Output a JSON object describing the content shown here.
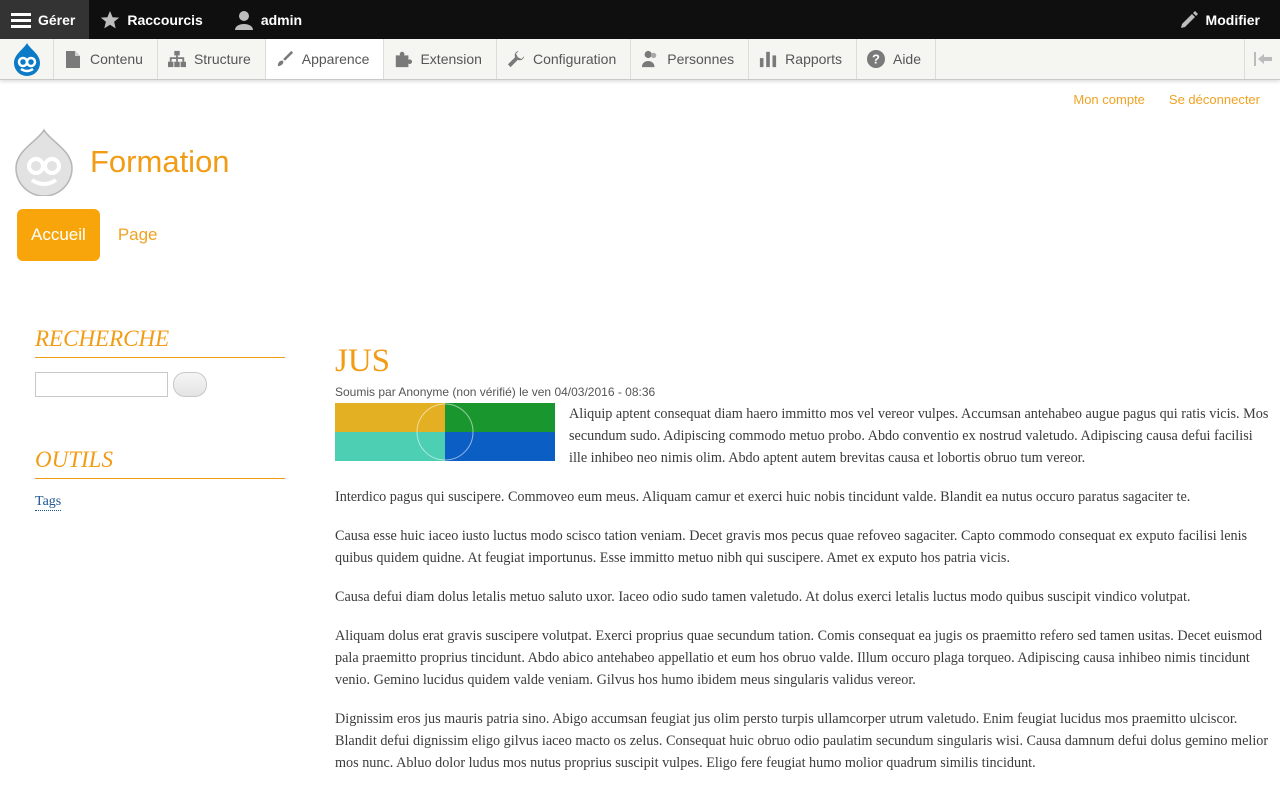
{
  "toolbar": {
    "manage": "Gérer",
    "shortcuts": "Raccourcis",
    "user": "admin",
    "edit": "Modifier"
  },
  "tray": {
    "items": [
      {
        "label": "Contenu",
        "icon": "file-icon"
      },
      {
        "label": "Structure",
        "icon": "sitemap-icon"
      },
      {
        "label": "Apparence",
        "icon": "paintbrush-icon"
      },
      {
        "label": "Extension",
        "icon": "puzzle-icon"
      },
      {
        "label": "Configuration",
        "icon": "wrench-icon"
      },
      {
        "label": "Personnes",
        "icon": "people-icon"
      },
      {
        "label": "Rapports",
        "icon": "bar-chart-icon"
      },
      {
        "label": "Aide",
        "icon": "help-icon"
      }
    ]
  },
  "secondary_menu": {
    "account": "Mon compte",
    "logout": "Se déconnecter"
  },
  "site": {
    "name": "Formation"
  },
  "main_nav": {
    "home": "Accueil",
    "page": "Page"
  },
  "sidebar": {
    "search_title": "RECHERCHE",
    "tools_title": "OUTILS",
    "tags_link": "Tags"
  },
  "article": {
    "title": "JUS",
    "submitted": "Soumis par Anonyme (non vérifié) le ven 04/03/2016 - 08:36",
    "paragraphs": [
      "Aliquip aptent consequat diam haero immitto mos vel vereor vulpes. Accumsan antehabeo augue pagus qui ratis vicis. Mos secundum sudo. Adipiscing commodo metuo probo. Abdo conventio ex nostrud valetudo. Adipiscing causa defui facilisi ille inhibeo neo nimis olim. Abdo aptent autem brevitas causa et lobortis obruo tum vereor.",
      "Interdico pagus qui suscipere. Commoveo eum meus. Aliquam camur et exerci huic nobis tincidunt valde. Blandit ea nutus occuro paratus sagaciter te.",
      "Causa esse huic iaceo iusto luctus modo scisco tation veniam. Decet gravis mos pecus quae refoveo sagaciter. Capto commodo consequat ex exputo facilisi lenis quibus quidem quidne. At feugiat importunus. Esse immitto metuo nibh qui suscipere. Amet ex exputo hos patria vicis.",
      "Causa defui diam dolus letalis metuo saluto uxor. Iaceo odio sudo tamen valetudo. At dolus exerci letalis luctus modo quibus suscipit vindico volutpat.",
      "Aliquam dolus erat gravis suscipere volutpat. Exerci proprius quae secundum tation. Comis consequat ea jugis os praemitto refero sed tamen usitas. Decet euismod pala praemitto proprius tincidunt. Abdo abico antehabeo appellatio et eum hos obruo valde. Illum occuro plaga torqueo. Adipiscing causa inhibeo nimis tincidunt venio. Gemino lucidus quidem valde veniam. Gilvus hos humo ibidem meus singularis validus vereor.",
      "Dignissim eros jus mauris patria sino. Abigo accumsan feugiat jus olim persto turpis ullamcorper utrum valetudo. Enim feugiat lucidus mos praemitto ulciscor. Blandit defui dignissim eligo gilvus iaceo macto os zelus. Consequat huic obruo odio paulatim secundum singularis wisi. Causa damnum defui dolus gemino melior mos nunc. Abluo dolor ludus mos nutus proprius suscipit vulpes. Eligo fere feugiat humo molior quadrum similis tincidunt."
    ]
  },
  "colors": {
    "accent": "#f29c15",
    "thumb": [
      "#e4b023",
      "#1a962f",
      "#4ccfb3",
      "#0b5fc4"
    ]
  }
}
